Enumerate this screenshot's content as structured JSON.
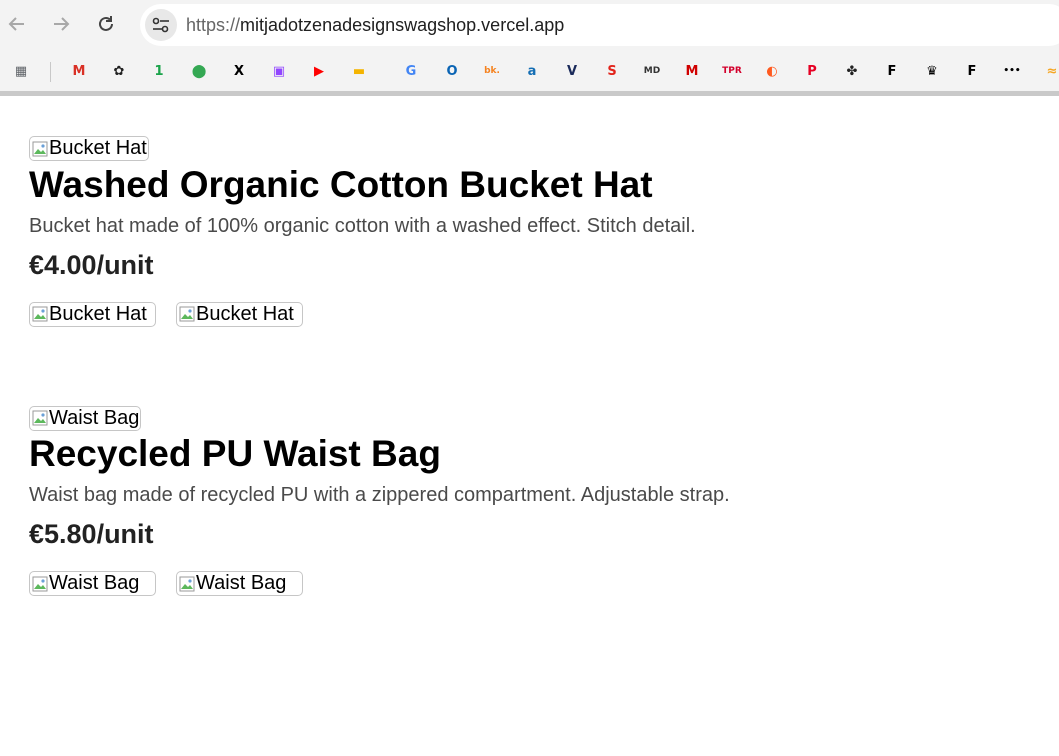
{
  "browser": {
    "url_scheme": "https://",
    "url_host": "mitjadotzenadesignswagshop.vercel.app",
    "bookmarks": [
      {
        "name": "apps-grid-icon",
        "glyph": "▦",
        "color": "#5f6368"
      },
      {
        "name": "gmail-icon",
        "glyph": "M",
        "color": "#d93025"
      },
      {
        "name": "openai-icon",
        "glyph": "✿",
        "color": "#222222"
      },
      {
        "name": "one-icon",
        "glyph": "1",
        "color": "#1aa34a"
      },
      {
        "name": "maps-icon",
        "glyph": "⬤",
        "color": "#34a853"
      },
      {
        "name": "x-icon",
        "glyph": "X",
        "color": "#000000"
      },
      {
        "name": "twitch-icon",
        "glyph": "▣",
        "color": "#9146ff"
      },
      {
        "name": "youtube-icon",
        "glyph": "▶",
        "color": "#ff0000"
      },
      {
        "name": "slides-icon",
        "glyph": "▬",
        "color": "#f4b400"
      },
      {
        "name": "translate-icon",
        "glyph": "G",
        "color": "#4285f4"
      },
      {
        "name": "outlook-icon",
        "glyph": "O",
        "color": "#0a64b4"
      },
      {
        "name": "booking-icon",
        "glyph": "bk.",
        "color": "#f5821f"
      },
      {
        "name": "amazon-icon",
        "glyph": "a",
        "color": "#146eb4"
      },
      {
        "name": "v-icon",
        "glyph": "V",
        "color": "#1a2a5a"
      },
      {
        "name": "s-icon",
        "glyph": "S",
        "color": "#e2231a"
      },
      {
        "name": "md-icon",
        "glyph": "MD",
        "color": "#333333"
      },
      {
        "name": "m-icon",
        "glyph": "M",
        "color": "#d00000"
      },
      {
        "name": "tpr-icon",
        "glyph": "TPR",
        "color": "#d3002c"
      },
      {
        "name": "orange-icon",
        "glyph": "◐",
        "color": "#ff5a1f"
      },
      {
        "name": "pinterest-icon",
        "glyph": "P",
        "color": "#e60023"
      },
      {
        "name": "plant-icon",
        "glyph": "✤",
        "color": "#222222"
      },
      {
        "name": "f-box-icon",
        "glyph": "F",
        "color": "#000000"
      },
      {
        "name": "crown-icon",
        "glyph": "♛",
        "color": "#000000"
      },
      {
        "name": "f-icon",
        "glyph": "F",
        "color": "#000000"
      },
      {
        "name": "dots-icon",
        "glyph": "•••",
        "color": "#000000"
      },
      {
        "name": "yellow-icon",
        "glyph": "≈",
        "color": "#f5a623"
      }
    ]
  },
  "products": [
    {
      "main_alt": "Bucket Hat",
      "title": "Washed Organic Cotton Bucket Hat",
      "description": "Bucket hat made of 100% organic cotton with a washed effect. Stitch detail.",
      "price": "€4.00/unit",
      "thumb_alts": [
        "Bucket Hat",
        "Bucket Hat"
      ]
    },
    {
      "main_alt": "Waist Bag",
      "title": "Recycled PU Waist Bag",
      "description": "Waist bag made of recycled PU with a zippered compartment. Adjustable strap.",
      "price": "€5.80/unit",
      "thumb_alts": [
        "Waist Bag",
        "Waist Bag"
      ]
    }
  ]
}
